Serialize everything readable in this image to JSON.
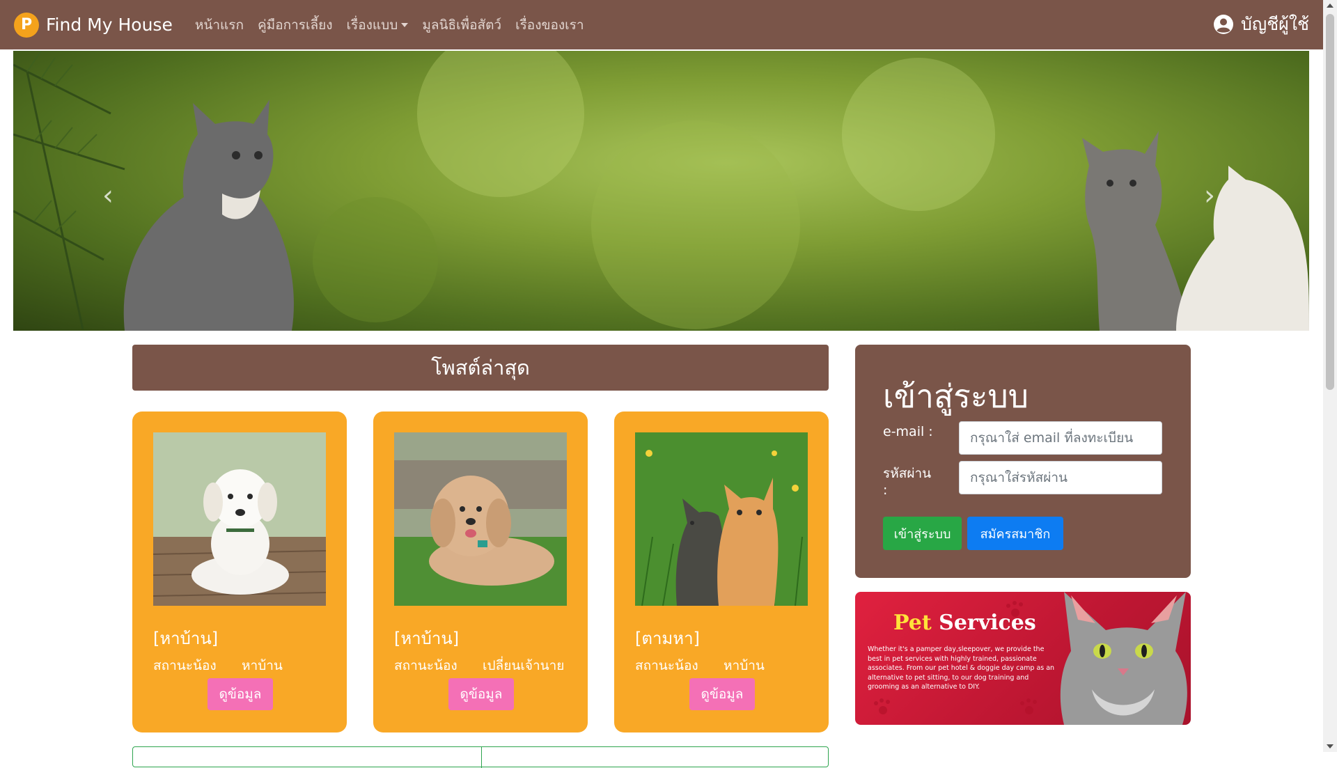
{
  "navbar": {
    "brand_badge": "P",
    "brand_name": "Find My House",
    "items": [
      {
        "label": "หน้าแรก"
      },
      {
        "label": "คู่มือการเลี้ยง"
      },
      {
        "label": "เรื่องแบบ",
        "dropdown": true
      },
      {
        "label": "มูลนิธิเพื่อสัตว์"
      },
      {
        "label": "เรื่องของเรา"
      }
    ],
    "account_label": "บัญชีผู้ใช้",
    "account_icon": "user-circle-icon",
    "background_color": "#7a5549"
  },
  "hero": {
    "prev_icon": "‹",
    "next_icon": "›",
    "subject": "kittens-on-green-background"
  },
  "posts": {
    "header": "โพสต์ล่าสุด",
    "status_label": "สถานะน้อง",
    "view_button": "ดูข้อมูล",
    "items": [
      {
        "type": "[หาบ้าน]",
        "status": "หาบ้าน",
        "photo": "white-puppy"
      },
      {
        "type": "[หาบ้าน]",
        "status": "เปลี่ยนเจ้านาย",
        "photo": "poodle-dog"
      },
      {
        "type": "[ตามหา]",
        "status": "หาบ้าน",
        "photo": "two-kittens"
      }
    ],
    "card_color": "#f9a826",
    "button_color": "#f470b6"
  },
  "login": {
    "title": "เข้าสู่ระบบ",
    "email_label": "e-mail :",
    "email_placeholder": "กรุณาใส่ email ที่ลงทะเบียน",
    "password_label": "รหัสผ่าน",
    "password_colon": ":",
    "password_placeholder": "กรุณาใส่รหัสผ่าน",
    "login_button": "เข้าสู่ระบบ",
    "register_button": "สมัครสมาชิก"
  },
  "banner": {
    "title_pet": "Pet",
    "title_services": "Services",
    "text": "Whether it's a pamper day,sleepover, we provide the best in pet services with highly trained, passionate associates. From our pet hotel & doggie day camp as an alternative to pet sitting, to our dog training and grooming as an alternative to DIY."
  }
}
